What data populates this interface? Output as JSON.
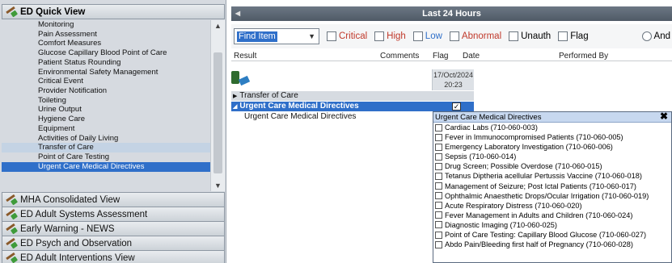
{
  "left_panel": {
    "title": "ED Quick View",
    "items": [
      "Monitoring",
      "Pain Assessment",
      "Comfort Measures",
      "Glucose Capillary Blood Point of Care",
      "Patient Status Rounding",
      "Environmental Safety Management",
      "Critical Event",
      "Provider Notification",
      "Toileting",
      "Urine Output",
      "Hygiene Care",
      "Equipment",
      "Activities of Daily Living",
      "Transfer of Care",
      "Point of Care Testing",
      "Urgent Care Medical Directives"
    ],
    "selected_item": "Urgent Care Medical Directives",
    "highlighted_item": "Transfer of Care",
    "bands": [
      "MHA Consolidated View",
      "ED Adult Systems Assessment",
      "Early Warning - NEWS",
      "ED Psych and Observation",
      "ED Adult Interventions View"
    ]
  },
  "right_panel": {
    "title": "Last 24 Hours",
    "find_item": "Find Item",
    "filters": {
      "critical": "Critical",
      "high": "High",
      "low": "Low",
      "abnormal": "Abnormal",
      "unauth": "Unauth",
      "flag": "Flag",
      "and": "And"
    },
    "columns": {
      "result": "Result",
      "comments": "Comments",
      "flag": "Flag",
      "date": "Date",
      "performed_by": "Performed By"
    },
    "date_header": {
      "date": "17/Oct/2024",
      "time": "20:23"
    },
    "rows": {
      "section1": "Transfer of Care",
      "section2": "Urgent Care Medical Directives",
      "item": "Urgent Care Medical Directives"
    }
  },
  "popup": {
    "title": "Urgent Care Medical Directives",
    "options": [
      "Cardiac Labs (710-060-003)",
      "Fever in Immunocompromised Patients (710-060-005)",
      "Emergency Laboratory Investigation (710-060-006)",
      "Sepsis (710-060-014)",
      "Drug Screen; Possible Overdose (710-060-015)",
      "Tetanus Diptheria acellular Pertussis Vaccine (710-060-018)",
      "Management of Seizure; Post Ictal Patients (710-060-017)",
      "Ophthalmic Anaesthetic Drops/Ocular Irrigation (710-060-019)",
      "Acute Respiratory Distress (710-060-020)",
      "Fever Management in Adults and Children (710-060-024)",
      "Diagnostic Imaging (710-060-025)",
      "Point of Care Testing: Capillary Blood Glucose (710-060-027)",
      "Abdo Pain/Bleeding first half of Pregnancy (710-060-028)"
    ]
  },
  "colors": {
    "selection_blue": "#2f6fc9",
    "title_bar": "#5b6672",
    "critical": "#c0392b",
    "high": "#c0392b",
    "low": "#2f6fc9",
    "abnormal": "#c0392b"
  },
  "icons": {
    "band_icon": "syringe-icon",
    "grid_icon": "chart-icon",
    "close": "close-icon"
  }
}
